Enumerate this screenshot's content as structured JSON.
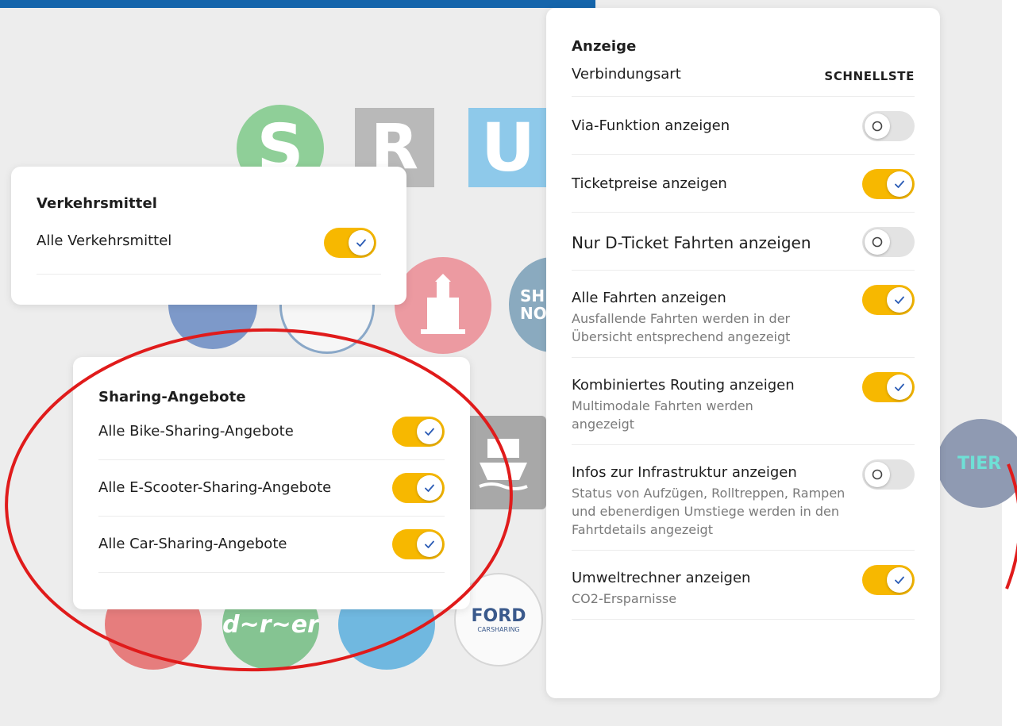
{
  "colors": {
    "accent_toggle_on": "#f7b800",
    "toggle_off": "#e3e3e3",
    "check_mark": "#2a5bb5",
    "topbar": "#1565ab",
    "annotation_circle": "#e01b1b"
  },
  "background_logos": {
    "s_bahn": "S",
    "regional": "R",
    "u_bahn": "U",
    "partial_badge": "SH NO",
    "tier": "TIER",
    "ford_main": "FORD",
    "ford_sub": "CARSHARING",
    "drivy_like": "d~r~er"
  },
  "verkehrsmittel": {
    "title": "Verkehrsmittel",
    "items": [
      {
        "label": "Alle Verkehrsmittel",
        "on": true
      }
    ]
  },
  "sharing": {
    "title": "Sharing-Angebote",
    "items": [
      {
        "label": "Alle Bike-Sharing-Angebote",
        "on": true
      },
      {
        "label": "Alle E-Scooter-Sharing-Angebote",
        "on": true
      },
      {
        "label": "Alle Car-Sharing-Angebote",
        "on": true
      }
    ]
  },
  "anzeige": {
    "title": "Anzeige",
    "verbindungsart_label": "Verbindungsart",
    "verbindungsart_value": "SCHNELLSTE",
    "items": [
      {
        "label": "Via-Funktion anzeigen",
        "on": false
      },
      {
        "label": "Ticketpreise anzeigen",
        "on": true
      },
      {
        "label": "Nur D-Ticket Fahrten anzeigen",
        "on": false
      },
      {
        "label": "Alle Fahrten anzeigen",
        "sub": "Ausfallende Fahrten werden in der Übersicht entsprechend angezeigt",
        "on": true
      },
      {
        "label": "Kombiniertes Routing anzeigen",
        "sub": "Multimodale Fahrten werden angezeigt",
        "on": true
      },
      {
        "label": "Infos zur Infrastruktur anzeigen",
        "sub": "Status von Aufzügen, Rolltreppen, Rampen und ebenerdigen Umstiege werden in den Fahrtdetails angezeigt",
        "on": false
      },
      {
        "label": "Umweltrechner anzeigen",
        "sub": "CO2-Ersparnisse",
        "on": true
      }
    ]
  }
}
